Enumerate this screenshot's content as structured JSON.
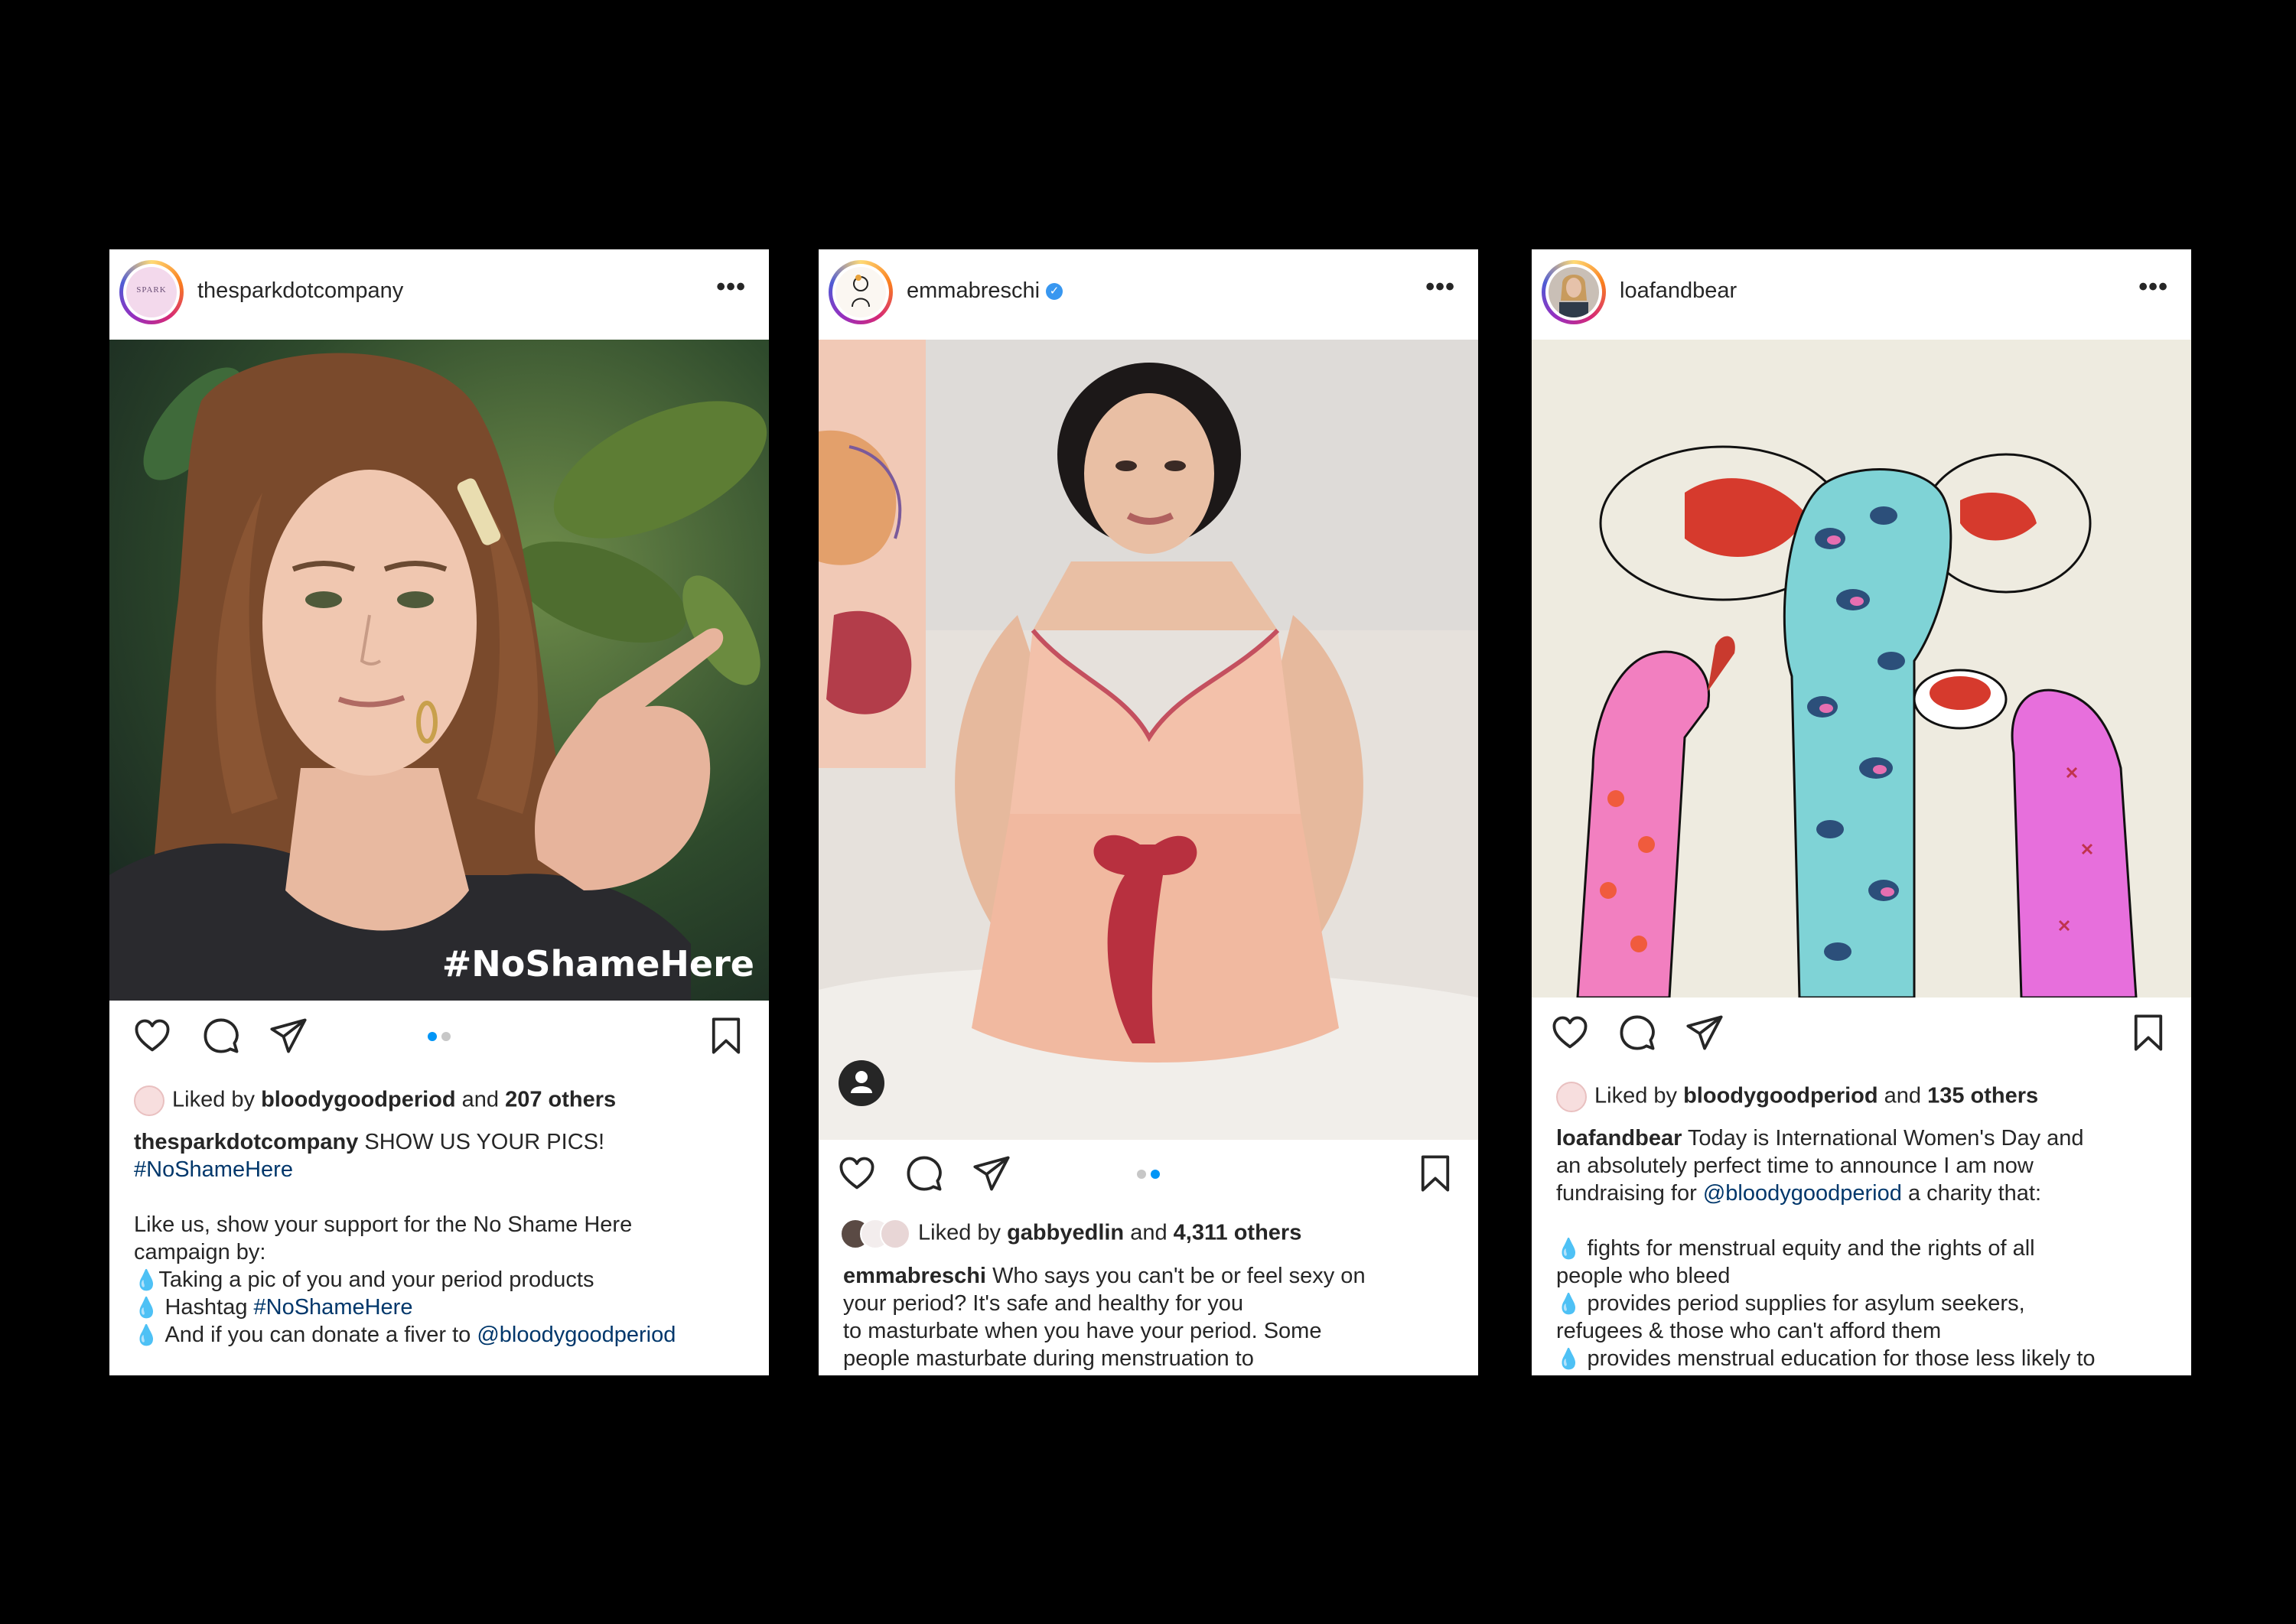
{
  "posts": [
    {
      "username": "thesparkdotcompany",
      "avatar_text": "SPARK",
      "image_overlay": "#NoShameHere",
      "likes": {
        "prefix": "Liked by",
        "user": "bloodygoodperiod",
        "mid": "and",
        "others": "207 others"
      },
      "caption": {
        "user": "thesparkdotcompany",
        "first": "SHOW US YOUR PICS!",
        "hashtag": "#NoShameHere",
        "p1": "Like us, show your support for the No Shame Here",
        "p2": "campaign by:",
        "b1": "Taking a pic of you and your period products",
        "b2_pre": "Hashtag",
        "b2_tag": "#NoShameHere",
        "b3_pre": "And if you can donate a fiver to",
        "b3_tag": "@bloodygoodperiod"
      }
    },
    {
      "username": "emmabreschi",
      "likes": {
        "prefix": "Liked by",
        "user": "gabbyedlin",
        "mid": "and",
        "others": "4,311 others"
      },
      "caption": {
        "user": "emmabreschi",
        "l1": "Who says you can't be or feel sexy on",
        "l2": "your period? It's safe and healthy for you",
        "l3": "to masturbate when you have your period. Some",
        "l4": "people masturbate during menstruation to"
      }
    },
    {
      "username": "loafandbear",
      "likes": {
        "prefix": "Liked by",
        "user": "bloodygoodperiod",
        "mid": "and",
        "others": "135 others"
      },
      "caption": {
        "user": "loafandbear",
        "l1": "Today is International Women's Day and",
        "l2": "an absolutely perfect time to announce I am now",
        "l3_pre": "fundraising for",
        "l3_tag": "@bloodygoodperiod",
        "l3_post": "a charity that:",
        "b1a": "fights for menstrual equity and the rights of all",
        "b1b": "people who bleed",
        "b2a": "provides period supplies for asylum seekers,",
        "b2b": "refugees & those who can't afford them",
        "b3a": "provides menstrual education for those less likely to"
      }
    }
  ],
  "icons": [
    "heart-icon",
    "comment-icon",
    "share-icon",
    "bookmark-icon",
    "more-icon",
    "verified-icon",
    "drop-icon",
    "user-tag-icon"
  ],
  "colors": {
    "link": "#00376b",
    "active_dot": "#0095f6",
    "verified": "#3897f0",
    "drop": "#d0021b"
  },
  "carousel": [
    {
      "count": 2,
      "active": 1
    },
    {
      "count": 2,
      "active": 2
    }
  ]
}
